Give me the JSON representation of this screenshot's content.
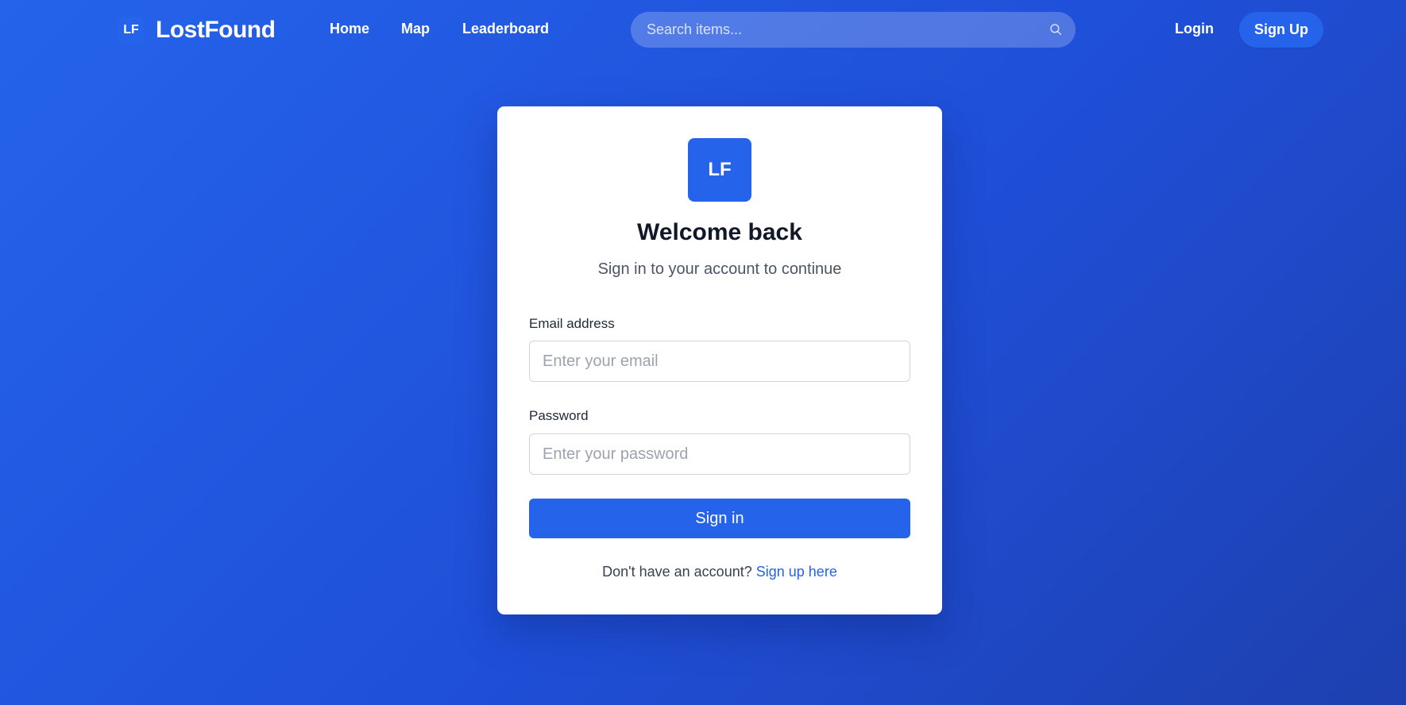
{
  "navbar": {
    "brand_badge": "LF",
    "brand_name": "LostFound",
    "links": [
      "Home",
      "Map",
      "Leaderboard"
    ],
    "search_placeholder": "Search items...",
    "login_label": "Login",
    "signup_label": "Sign Up"
  },
  "card": {
    "logo_text": "LF",
    "title": "Welcome back",
    "subtitle": "Sign in to your account to continue",
    "email_label": "Email address",
    "email_placeholder": "Enter your email",
    "password_label": "Password",
    "password_placeholder": "Enter your password",
    "submit_label": "Sign in",
    "footer_text": "Don't have an account?",
    "footer_link": "Sign up here"
  },
  "colors": {
    "accent": "#2563eb",
    "background_start": "#2563eb",
    "background_end": "#1e40af",
    "heading": "#111827"
  },
  "icons": [
    "search-icon"
  ]
}
